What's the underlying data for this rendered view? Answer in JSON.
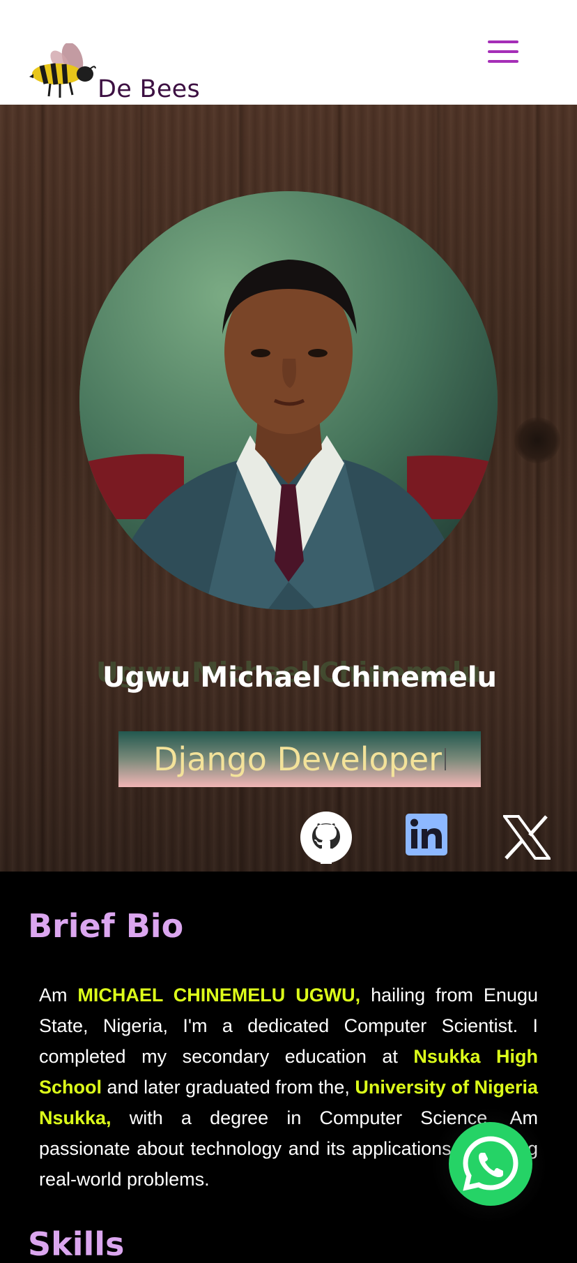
{
  "header": {
    "brand": "De Bees",
    "logo_icon": "bee-icon",
    "menu_icon": "hamburger-menu-icon",
    "menu_color": "#a52fb7"
  },
  "hero": {
    "name": "Ugwu Michael Chinemelu",
    "role": "Django Developer",
    "socials": [
      {
        "name": "GitHub",
        "icon": "github-icon"
      },
      {
        "name": "LinkedIn",
        "icon": "linkedin-icon"
      },
      {
        "name": "X",
        "icon": "x-icon"
      }
    ]
  },
  "bio": {
    "title": "Brief Bio",
    "p1": "Am ",
    "name_hl": "MICHAEL CHINEMELU UGWU,",
    "p2": " hailing from Enugu State, Nigeria, I'm a dedicated Computer Scientist. I completed my secondary education at ",
    "school_hl": "Nsukka High School",
    "p3": " and later graduated from the, ",
    "uni_hl": "University of Nigeria Nsukka,",
    "p4": " with a degree in Computer Science. Am passionate about technology and its applications in solving real-world problems."
  },
  "skills": {
    "title": "Skills"
  },
  "floating": {
    "whatsapp_icon": "whatsapp-icon"
  },
  "colors": {
    "accent": "#dba6ef",
    "highlight": "#ddff1a",
    "role_text": "#f3e29a",
    "whatsapp": "#25d366"
  }
}
